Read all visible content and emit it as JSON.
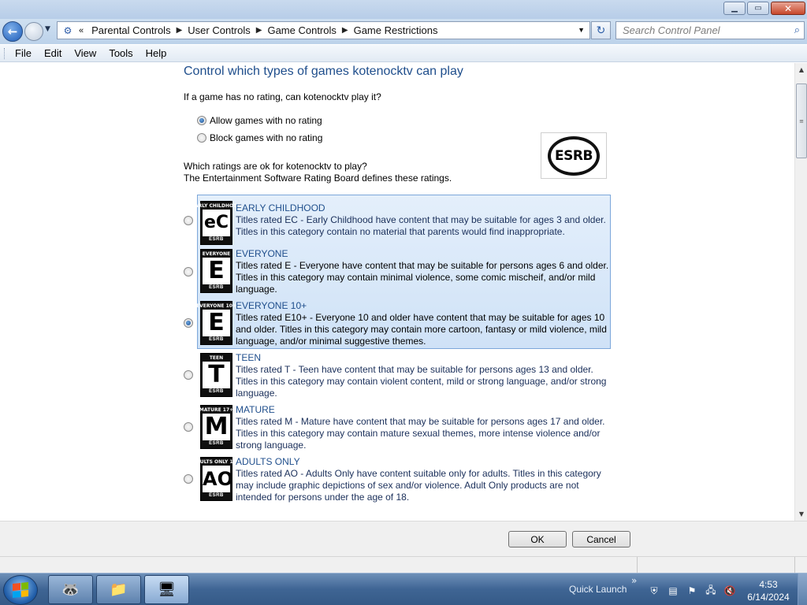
{
  "window": {
    "controls": {
      "minimize": "▁",
      "maximize": "▭",
      "close": "✕"
    }
  },
  "nav": {
    "back_icon": "back-arrow-icon",
    "forward_icon": "forward-arrow-icon",
    "breadcrumb": [
      "Parental Controls",
      "User Controls",
      "Game Controls",
      "Game Restrictions"
    ],
    "overflow": "«"
  },
  "search": {
    "placeholder": "Search Control Panel"
  },
  "menu": [
    "File",
    "Edit",
    "View",
    "Tools",
    "Help"
  ],
  "page": {
    "title": "Control which types of games kotenocktv can play",
    "no_rating_question": "If a game has no rating, can kotenocktv play it?",
    "allow_no_rating": "Allow games with no rating",
    "block_no_rating": "Block games with no rating",
    "no_rating_selected": "allow",
    "esrb_logo_text": "ESRB",
    "ratings_question": "Which ratings are ok for kotenocktv to play?",
    "ratings_note": "The Entertainment Software Rating Board defines these ratings.",
    "selected_rating": "EVERYONE 10+"
  },
  "ratings": [
    {
      "name": "EARLY CHILDHOOD",
      "badge_top": "EARLY CHILDHOOD",
      "badge_letter": "eC",
      "desc": "Titles rated EC - Early Childhood have content that may be suitable for ages 3 and older. Titles in this category contain no material that parents would find inappropriate."
    },
    {
      "name": "EVERYONE",
      "badge_top": "EVERYONE",
      "badge_letter": "E",
      "desc": "Titles rated E - Everyone have content that may be suitable for persons ages 6 and older. Titles in this category may contain minimal violence, some comic mischeif, and/or mild language."
    },
    {
      "name": "EVERYONE 10+",
      "badge_top": "EVERYONE 10+",
      "badge_letter": "E",
      "desc": "Titles rated E10+ - Everyone 10 and older have content that may be suitable for ages 10 and older. Titles in this category may contain more cartoon, fantasy or mild violence, mild language, and/or minimal suggestive themes."
    },
    {
      "name": "TEEN",
      "badge_top": "TEEN",
      "badge_letter": "T",
      "desc": "Titles rated T - Teen have content that may be suitable for persons ages 13 and older. Titles in this category may contain violent content, mild or strong language, and/or strong language."
    },
    {
      "name": "MATURE",
      "badge_top": "MATURE 17+",
      "badge_letter": "M",
      "desc": "Titles rated M - Mature have content that may be suitable for persons ages 17 and older. Titles in this category may contain mature sexual themes, more intense violence and/or strong language."
    },
    {
      "name": "ADULTS ONLY",
      "badge_top": "ADULTS ONLY 18+",
      "badge_letter": "AO",
      "desc": "Titles rated AO - Adults Only have content suitable only for adults.  Titles in this category may include graphic depictions of sex and/or violence.  Adult Only products are not intended for persons under the age of 18."
    }
  ],
  "badge_footer": "ESRB",
  "buttons": {
    "ok": "OK",
    "cancel": "Cancel"
  },
  "taskbar": {
    "quick_launch": "Quick Launch",
    "time": "4:53",
    "date": "6/14/2024",
    "overflow": "»"
  },
  "colors": {
    "link_blue": "#1f4e8c",
    "selection_bg": "#d8e8f9"
  }
}
